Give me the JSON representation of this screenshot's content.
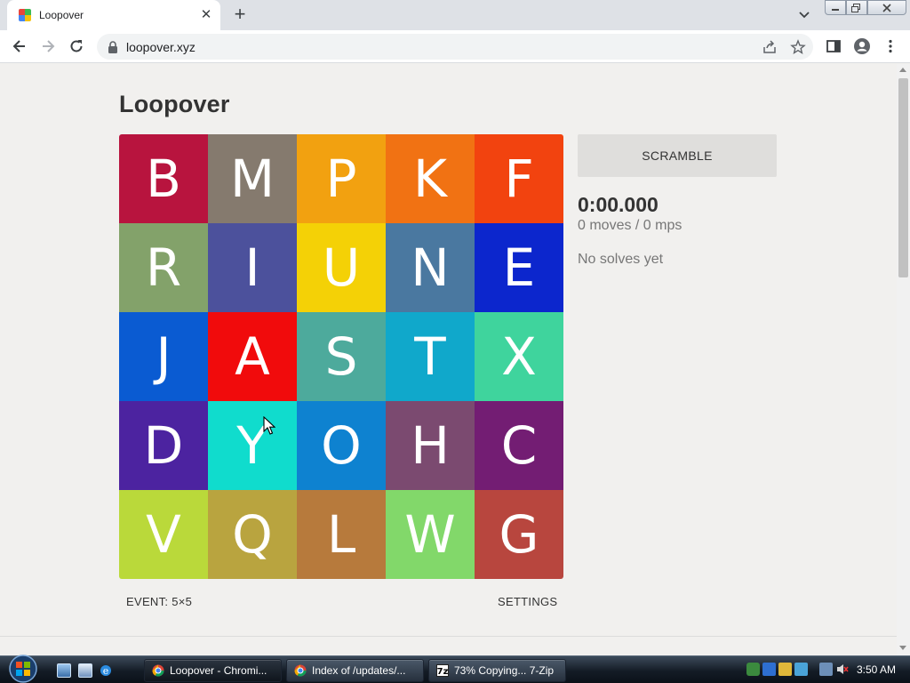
{
  "browser": {
    "tab_title": "Loopover",
    "url": "loopover.xyz"
  },
  "page": {
    "title": "Loopover",
    "scramble_label": "SCRAMBLE",
    "timer": "0:00.000",
    "moves_text": "0 moves / 0 mps",
    "solves_text": "No solves yet",
    "event_label": "EVENT: 5×5",
    "settings_label": "SETTINGS"
  },
  "board": {
    "rows": [
      [
        {
          "letter": "B",
          "color": "#b8143e"
        },
        {
          "letter": "M",
          "color": "#857a6e"
        },
        {
          "letter": "P",
          "color": "#f2a110"
        },
        {
          "letter": "K",
          "color": "#f17213"
        },
        {
          "letter": "F",
          "color": "#f2430f"
        }
      ],
      [
        {
          "letter": "R",
          "color": "#83a26a"
        },
        {
          "letter": "I",
          "color": "#4c519c"
        },
        {
          "letter": "U",
          "color": "#f4d106"
        },
        {
          "letter": "N",
          "color": "#4a78a0"
        },
        {
          "letter": "E",
          "color": "#0c26cd"
        }
      ],
      [
        {
          "letter": "J",
          "color": "#0a5bd2"
        },
        {
          "letter": "A",
          "color": "#f10b0c"
        },
        {
          "letter": "S",
          "color": "#4daa9c"
        },
        {
          "letter": "T",
          "color": "#10a8cb"
        },
        {
          "letter": "X",
          "color": "#3fd49d"
        }
      ],
      [
        {
          "letter": "D",
          "color": "#4c23a0"
        },
        {
          "letter": "Y",
          "color": "#10dccd"
        },
        {
          "letter": "O",
          "color": "#0e82d0"
        },
        {
          "letter": "H",
          "color": "#7b4a70"
        },
        {
          "letter": "C",
          "color": "#731d73"
        }
      ],
      [
        {
          "letter": "V",
          "color": "#bad93a"
        },
        {
          "letter": "Q",
          "color": "#b9a43f"
        },
        {
          "letter": "L",
          "color": "#b77a3c"
        },
        {
          "letter": "W",
          "color": "#82d86a"
        },
        {
          "letter": "G",
          "color": "#b8463e"
        }
      ]
    ]
  },
  "taskbar": {
    "items": [
      {
        "label": "Loopover - Chromi...",
        "icon": "chrome-icon"
      },
      {
        "label": "Index of /updates/...",
        "icon": "chrome-icon"
      },
      {
        "label": "73% Copying... 7-Zip",
        "icon": "7zip-icon"
      }
    ],
    "clock": "3:50 AM"
  },
  "colors": {
    "page_bg": "#f1f0ee",
    "title_text": "#333333",
    "muted_text": "#777777",
    "button_bg": "#dfdedc"
  }
}
